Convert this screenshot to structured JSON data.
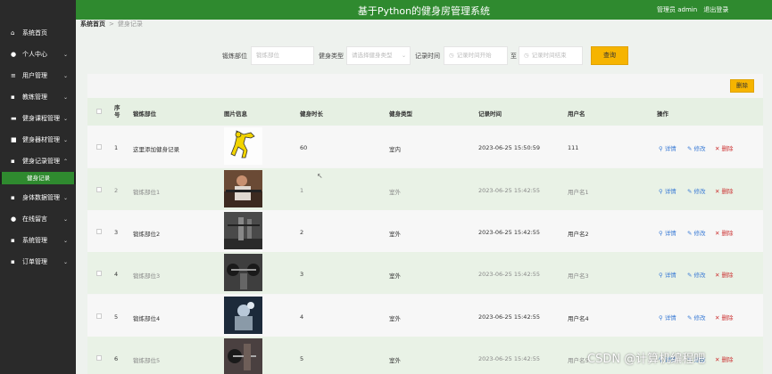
{
  "header": {
    "title": "基于Python的健身房管理系统",
    "admin_label": "管理员 admin",
    "logout_label": "退出登录"
  },
  "sidebar": {
    "items": [
      {
        "label": "系统首页",
        "icon": "home-icon",
        "arrow": ""
      },
      {
        "label": "个人中心",
        "icon": "user-icon",
        "arrow": "⌄"
      },
      {
        "label": "用户管理",
        "icon": "list-icon",
        "arrow": "⌄"
      },
      {
        "label": "教练管理",
        "icon": "grid-icon",
        "arrow": "⌄"
      },
      {
        "label": "健身课程管理",
        "icon": "monitor-icon",
        "arrow": "⌄"
      },
      {
        "label": "健身器材管理",
        "icon": "briefcase-icon",
        "arrow": "⌄"
      },
      {
        "label": "健身记录管理",
        "icon": "grid-icon",
        "arrow": "⌃"
      },
      {
        "label": "身体数据管理",
        "icon": "grid-icon",
        "arrow": "⌄"
      },
      {
        "label": "在线留言",
        "icon": "pin-icon",
        "arrow": "⌄"
      },
      {
        "label": "系统管理",
        "icon": "grid-icon",
        "arrow": "⌄"
      },
      {
        "label": "订单管理",
        "icon": "grid-icon",
        "arrow": "⌄"
      }
    ],
    "submenu": {
      "label": "健身记录"
    }
  },
  "breadcrumb": {
    "home": "系统首页",
    "separator": ">",
    "current": "健身记录"
  },
  "search": {
    "part_label": "锻炼部位",
    "part_placeholder": "锻炼部位",
    "type_label": "健身类型",
    "type_placeholder": "请选择健身类型",
    "time_label": "记录时间",
    "start_placeholder": "记录时间开始",
    "to_label": "至",
    "end_placeholder": "记录时间结束",
    "query_button": "查询"
  },
  "toolbar": {
    "delete_button": "删除"
  },
  "table": {
    "headers": {
      "index": "序号",
      "part": "锻炼部位",
      "image": "图片信息",
      "duration": "健身时长",
      "type": "健身类型",
      "time": "记录时间",
      "username": "用户名",
      "actions": "操作"
    },
    "actions": {
      "view": "详情",
      "edit": "修改",
      "delete": "删除"
    },
    "rows": [
      {
        "index": "1",
        "part": "这里添加健身记录",
        "duration": "60",
        "type": "室内",
        "time": "2023-06-25 15:50:59",
        "username": "111"
      },
      {
        "index": "2",
        "part": "锻炼部位1",
        "duration": "1",
        "type": "室外",
        "time": "2023-06-25 15:42:55",
        "username": "用户名1"
      },
      {
        "index": "3",
        "part": "锻炼部位2",
        "duration": "2",
        "type": "室外",
        "time": "2023-06-25 15:42:55",
        "username": "用户名2"
      },
      {
        "index": "4",
        "part": "锻炼部位3",
        "duration": "3",
        "type": "室外",
        "time": "2023-06-25 15:42:55",
        "username": "用户名3"
      },
      {
        "index": "5",
        "part": "锻炼部位4",
        "duration": "4",
        "type": "室外",
        "time": "2023-06-25 15:42:55",
        "username": "用户名4"
      },
      {
        "index": "6",
        "part": "锻炼部位5",
        "duration": "5",
        "type": "室外",
        "time": "2023-06-25 15:42:55",
        "username": "用户名5"
      }
    ]
  },
  "watermark": "CSDN @计算机编程吧",
  "colors": {
    "brand_green": "#2f8a2f",
    "accent_yellow": "#f6b400",
    "sidebar_bg": "#2a2a2a"
  }
}
